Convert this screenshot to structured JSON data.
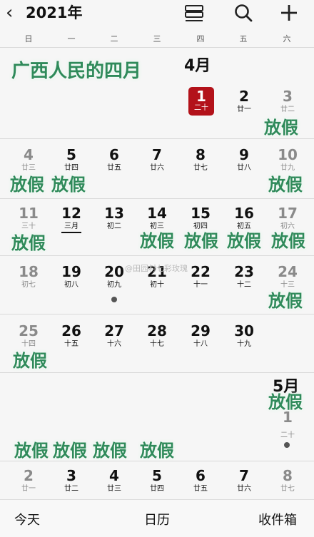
{
  "header": {
    "year": "2021年",
    "back_icon": "chevron-left-icon",
    "list_icon": "list-view-icon",
    "search_icon": "search-icon",
    "add_icon": "plus-icon"
  },
  "weekdays": [
    "日",
    "一",
    "二",
    "三",
    "四",
    "五",
    "六"
  ],
  "overlay_title": "广西人民的四月",
  "months": {
    "april": "4月",
    "may": "5月"
  },
  "holiday_label": "放假",
  "today": {
    "day": "1",
    "lunar": "二十"
  },
  "weeks": [
    [
      {
        "d": "2",
        "l": "廿一"
      },
      {
        "d": "3",
        "l": "廿二",
        "gray": true
      }
    ],
    [
      {
        "d": "4",
        "l": "廿三",
        "gray": true
      },
      {
        "d": "5",
        "l": "廿四"
      },
      {
        "d": "6",
        "l": "廿五"
      },
      {
        "d": "7",
        "l": "廿六"
      },
      {
        "d": "8",
        "l": "廿七"
      },
      {
        "d": "9",
        "l": "廿八"
      },
      {
        "d": "10",
        "l": "廿九",
        "gray": true
      }
    ],
    [
      {
        "d": "11",
        "l": "三十",
        "gray": true
      },
      {
        "d": "12",
        "l": "三月"
      },
      {
        "d": "13",
        "l": "初二"
      },
      {
        "d": "14",
        "l": "初三"
      },
      {
        "d": "15",
        "l": "初四"
      },
      {
        "d": "16",
        "l": "初五"
      },
      {
        "d": "17",
        "l": "初六",
        "gray": true
      }
    ],
    [
      {
        "d": "18",
        "l": "初七",
        "gray": true
      },
      {
        "d": "19",
        "l": "初八"
      },
      {
        "d": "20",
        "l": "初九"
      },
      {
        "d": "21",
        "l": "初十"
      },
      {
        "d": "22",
        "l": "十一"
      },
      {
        "d": "23",
        "l": "十二"
      },
      {
        "d": "24",
        "l": "十三",
        "gray": true
      }
    ],
    [
      {
        "d": "25",
        "l": "十四",
        "gray": true
      },
      {
        "d": "26",
        "l": "十五"
      },
      {
        "d": "27",
        "l": "十六"
      },
      {
        "d": "28",
        "l": "十七"
      },
      {
        "d": "29",
        "l": "十八"
      },
      {
        "d": "30",
        "l": "十九"
      }
    ],
    [
      {
        "d": "1",
        "l": "二十",
        "gray": true
      }
    ],
    [
      {
        "d": "2",
        "l": "廿一",
        "gray": true
      },
      {
        "d": "3",
        "l": "廿二"
      },
      {
        "d": "4",
        "l": "廿三"
      },
      {
        "d": "5",
        "l": "廿四"
      },
      {
        "d": "6",
        "l": "廿五"
      },
      {
        "d": "7",
        "l": "廿六"
      },
      {
        "d": "8",
        "l": "廿七",
        "gray": true
      }
    ]
  ],
  "watermark": "@田园村七彩玫瑰",
  "bottom": {
    "today": "今天",
    "calendar": "日历",
    "inbox": "收件箱"
  }
}
